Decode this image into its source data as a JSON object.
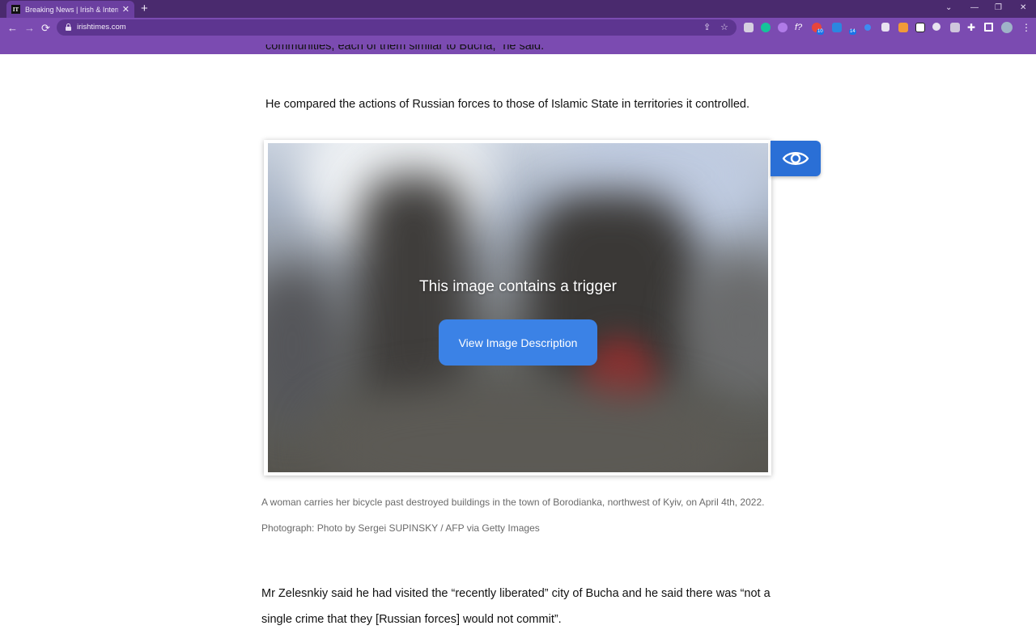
{
  "browser": {
    "tab_title": "Breaking News | Irish & International",
    "tab_favicon_text": "IT",
    "new_tab_glyph": "+",
    "url": "irishtimes.com",
    "window_controls": [
      "⌄",
      "—",
      "❐",
      "✕"
    ],
    "extension_badges": [
      "10",
      "14"
    ],
    "icons": [
      "back-icon",
      "forward-icon",
      "reload-icon",
      "lock-icon",
      "share-icon",
      "bookmark-star-icon",
      "extensions-puzzle-icon",
      "side-panel-icon",
      "profile-avatar-icon"
    ]
  },
  "article": {
    "cut_line": "communities, each of them similar to Bucha,” he said.",
    "paragraph_1": "He compared the actions of Russian forces to those of Islamic State in territories it controlled.",
    "image_overlay": {
      "title": "This image contains a trigger",
      "button_label": "View Image Description"
    },
    "caption": "A woman carries her bicycle past destroyed buildings in the town of Borodianka, northwest of Kyiv, on April 4th, 2022. Photograph: Photo by Sergei SUPINSKY / AFP via Getty Images",
    "paragraph_2": "Mr Zelesnkiy said he had visited the “recently liberated” city of Bucha and he said there was “not a single crime that they [Russian forces] would not commit”."
  },
  "colors": {
    "titlebar": "#4a2a6e",
    "toolbar": "#7b4bb1",
    "overlay_button": "#3b82e6",
    "eye_button": "#2a6fd6"
  }
}
